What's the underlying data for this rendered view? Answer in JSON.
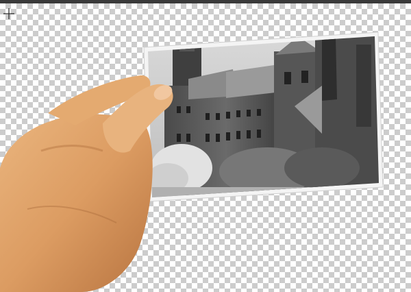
{
  "tool": {
    "cursor_icon": "crosshair-icon"
  },
  "colors": {
    "top_bar": "#3a3a3a",
    "checker_dark": "#cccccc",
    "checker_light": "#ffffff",
    "skin": "#e0a56a",
    "photo_border": "#f4f4f4"
  }
}
